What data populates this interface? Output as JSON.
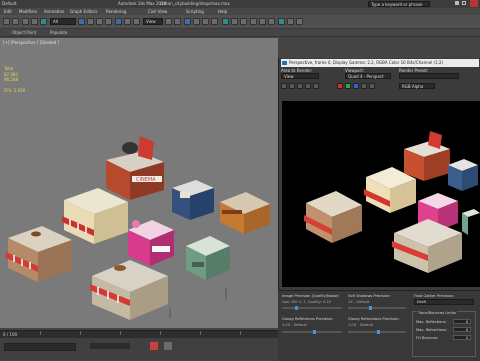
{
  "titlebar": {
    "workspace": "Default",
    "app_title": "Autodesk 3ds Max 2016",
    "filename": "carton_citybuilding/shopsmax.max",
    "search_placeholder": "Type a keyword or phrase"
  },
  "menubar": {
    "items": [
      "Edit",
      "Modifiers",
      "Animation",
      "Graph Editors",
      "Rendering",
      "Civil View",
      "Scripting",
      "Help"
    ]
  },
  "toolbar": {
    "selection_filter": "All",
    "view_dropdown": "View"
  },
  "ribbon": {
    "items": [
      "Object Paint",
      "Populate"
    ]
  },
  "viewport": {
    "label": "[+] [Perspective ] [Shaded ]",
    "stats": [
      "Total",
      "87,984",
      "98,288",
      "",
      "FPS: 5,920"
    ]
  },
  "buildings": {
    "cinema_sign": "CINEMA"
  },
  "frame_window": {
    "title": "Perspective, frame 0, Display Gamma: 2.2, RGBA Color 16 Bits/Channel (1:2)",
    "area_to_render_label": "Area to Render:",
    "area_to_render_value": "View",
    "viewport_label": "Viewport:",
    "viewport_value": "Quad 4 - Perspect",
    "render_preset_label": "Render Preset:",
    "channel_value": "RGB Alpha"
  },
  "render_settings": {
    "image_precision_label": "Image Precision (Quality/Noise):",
    "image_precision_value": "Low, Min 1..1, Quality: 0.25",
    "soft_shadow_label": "Soft Shadows Precision:",
    "soft_shadow_value": "1X - Default",
    "final_gather_label": "Final Gather Precision:",
    "final_gather_value": "Draft",
    "glossy_reflection_label": "Glossy Reflections Precision:",
    "glossy_reflection_value": "1.0X - Default",
    "glossy_refraction_label": "Glossy Refractions Precision:",
    "glossy_refraction_value": "1.0X - Default",
    "trace_bounce_label": "Trace/Bounces Limits",
    "max_reflections_label": "Max. Reflections:",
    "max_reflections_value": "6",
    "max_refractions_label": "Max. Refractions:",
    "max_refractions_value": "6",
    "fg_bounces_label": "FG Bounces:",
    "fg_bounces_value": "0"
  },
  "timeline": {
    "frame_label": "0 / 100"
  }
}
